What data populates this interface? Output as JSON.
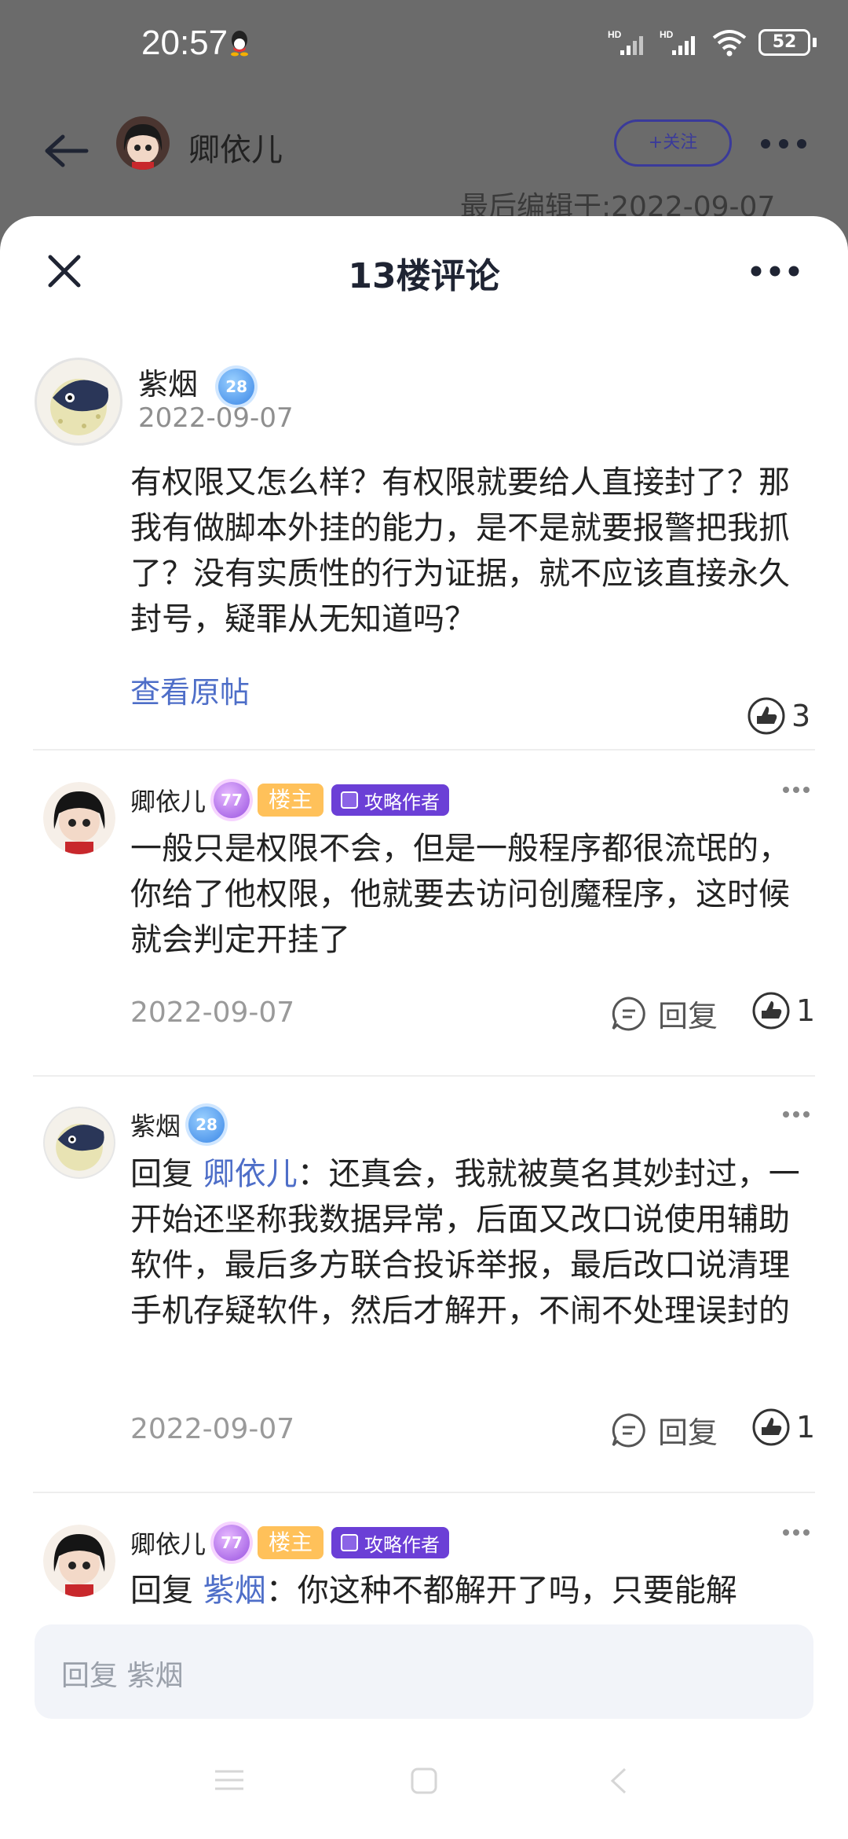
{
  "status_bar": {
    "time": "20:57",
    "battery": "52",
    "network_label": "HD"
  },
  "background_header": {
    "author_name": "卿依儿",
    "follow_label": "+关注",
    "edited_line": "最后编辑于:2022-09-07"
  },
  "sheet": {
    "title": "13楼评论"
  },
  "main_comment": {
    "user": "紫烟",
    "level": "28",
    "date": "2022-09-07",
    "text": "有权限又怎么样？有权限就要给人直接封了？那我有做脚本外挂的能力，是不是就要报警把我抓了？没有实质性的行为证据，就不应该直接永久封号，疑罪从无知道吗？",
    "view_original": "查看原帖",
    "likes": "3"
  },
  "replies": [
    {
      "user": "卿依儿",
      "level": "77",
      "owner_tag": "楼主",
      "author_tag": "攻略作者",
      "text": "一般只是权限不会，但是一般程序都很流氓的，你给了他权限，他就要去访问创魔程序，这时候就会判定开挂了",
      "date": "2022-09-07",
      "reply_label": "回复",
      "likes": "1"
    },
    {
      "user": "紫烟",
      "level": "28",
      "reply_prefix": "回复 ",
      "mention": "卿依儿",
      "text": "：还真会，我就被莫名其妙封过，一开始还坚称我数据异常，后面又改口说使用辅助软件，最后多方联合投诉举报，最后改口说清理手机存疑软件，然后才解开，不闹不处理误封的",
      "date": "2022-09-07",
      "reply_label": "回复",
      "likes": "1"
    },
    {
      "user": "卿依儿",
      "level": "77",
      "owner_tag": "楼主",
      "author_tag": "攻略作者",
      "reply_prefix": "回复 ",
      "mention": "紫烟",
      "text": "：你这种不都解开了吗，只要能解"
    }
  ],
  "input": {
    "placeholder": "回复 紫烟"
  },
  "colors": {
    "accent": "#4e6ec8",
    "owner_tag": "#ffc15a",
    "author_tag": "#6b3fd6",
    "overlay": "#6b6b6b"
  }
}
